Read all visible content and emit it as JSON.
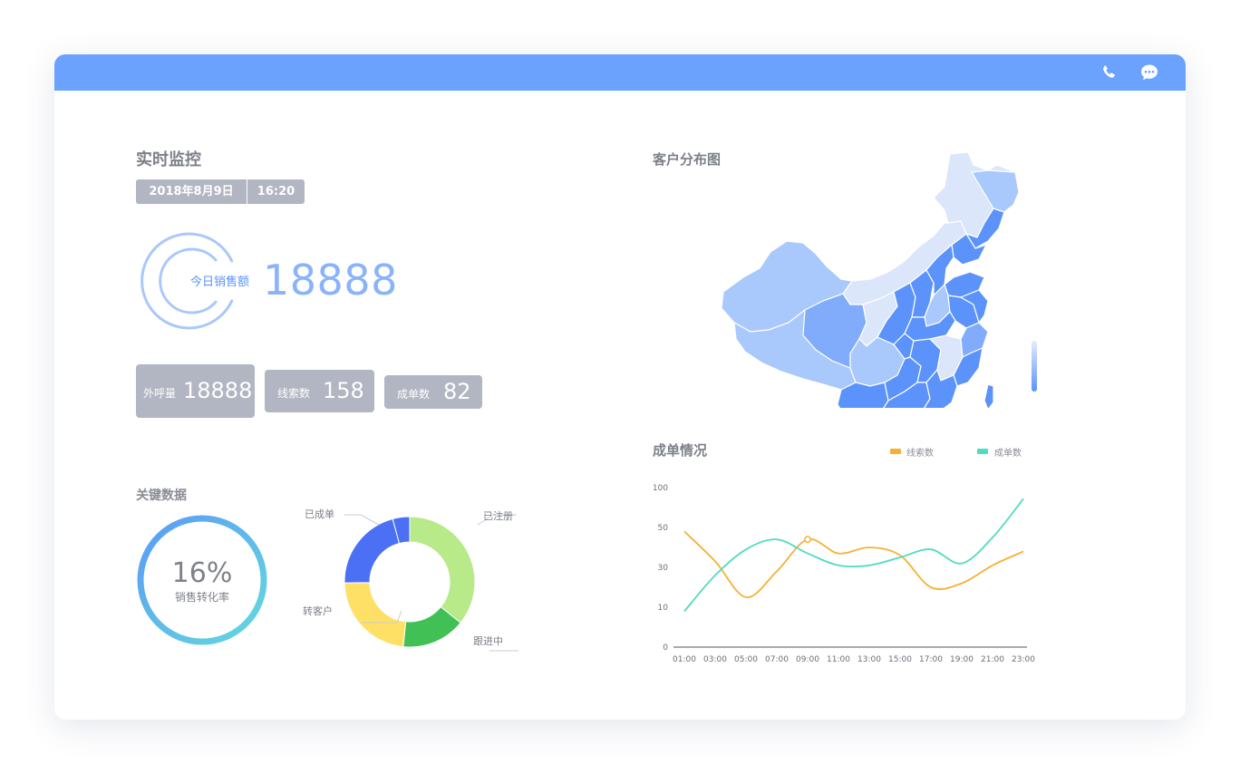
{
  "header": {
    "icons": [
      "phone-icon",
      "chat-bubble-icon"
    ],
    "color": "#6aa2fd"
  },
  "monitor": {
    "title": "实时监控",
    "date": "2018年8月9日",
    "time": "16:20",
    "sales_label": "今日销售额",
    "sales_value": "18888"
  },
  "kpis": [
    {
      "label": "外呼量",
      "value": "18888"
    },
    {
      "label": "线索数",
      "value": "158"
    },
    {
      "label": "成单数",
      "value": "82"
    }
  ],
  "key_data": {
    "title": "关键数据",
    "conversion_value": "16%",
    "conversion_label": "销售转化率",
    "conversion_fraction": 0.16
  },
  "donut": {
    "segments": [
      {
        "label": "已注册",
        "value": 34,
        "color": "#b8ea8a"
      },
      {
        "label": "跟进中",
        "value": 15,
        "color": "#41c055"
      },
      {
        "label": "转客户",
        "value": 22,
        "color": "#ffe067"
      },
      {
        "label": "已成单",
        "value": 20,
        "color": "#4b70f5"
      },
      {
        "label": "",
        "value": 4,
        "color": "#4b70f5"
      }
    ]
  },
  "map": {
    "title": "客户分布图",
    "colors": {
      "light": "#dbe6fb",
      "mid": "#a9c8fb",
      "dark": "#5b93fb"
    }
  },
  "orders": {
    "title": "成单情况",
    "legend": [
      {
        "name": "线索数",
        "color": "#f5b135"
      },
      {
        "name": "成单数",
        "color": "#4fdcc0"
      }
    ]
  },
  "chart_data": {
    "type": "line",
    "title": "成单情况",
    "x": [
      "01:00",
      "03:00",
      "05:00",
      "07:00",
      "09:00",
      "11:00",
      "13:00",
      "15:00",
      "17:00",
      "19:00",
      "21:00",
      "23:00"
    ],
    "y_ticks": [
      "0",
      "10",
      "30",
      "50",
      "100"
    ],
    "ylim": [
      0,
      100
    ],
    "series": [
      {
        "name": "线索数",
        "color": "#f5b135",
        "values": [
          48,
          33,
          15,
          28,
          44,
          37,
          40,
          36,
          20,
          22,
          31,
          38
        ]
      },
      {
        "name": "成单数",
        "color": "#4fdcc0",
        "values": [
          9,
          26,
          39,
          44,
          37,
          31,
          31,
          35,
          39,
          32,
          45,
          86
        ]
      }
    ],
    "legend_position": "top-right",
    "grid": false
  }
}
